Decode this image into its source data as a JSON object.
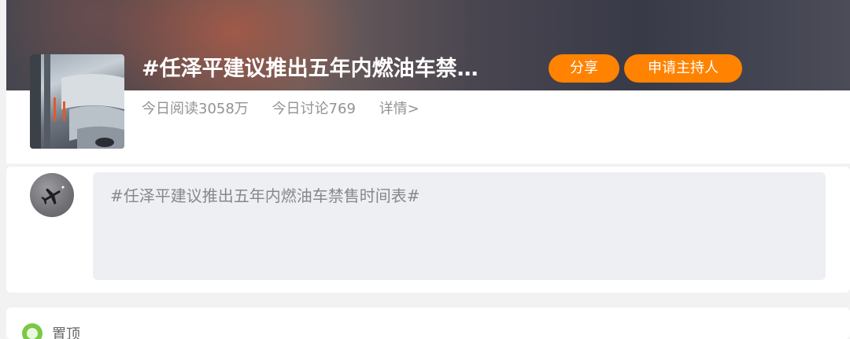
{
  "topic": {
    "title": "#任泽平建议推出五年内燃油车禁…",
    "share_label": "分享",
    "apply_host_label": "申请主持人",
    "stats": {
      "reads": "今日阅读3058万",
      "discussions": "今日讨论769",
      "details": "详情>"
    }
  },
  "compose": {
    "prefill_text": "#任泽平建议推出五年内燃油车禁售时间表#"
  },
  "feed": {
    "pinned_label": "置顶"
  },
  "colors": {
    "accent": "#ff8200",
    "stats_text": "#939393",
    "compose_bg": "#eeeff3",
    "pin_green": "#7ac943"
  },
  "icons": {
    "cover": "electric-car-charging-image",
    "avatar": "airplane-avatar",
    "pin": "pin-badge-icon"
  }
}
